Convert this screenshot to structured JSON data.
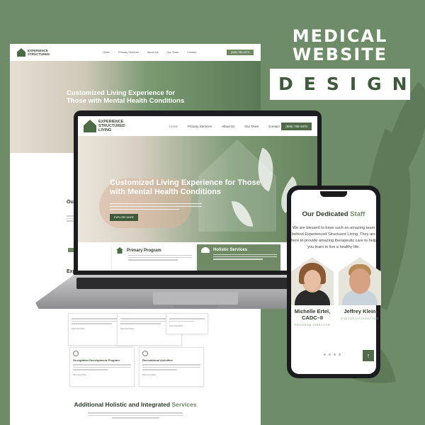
{
  "banner": {
    "line1": "MEDICAL",
    "line2": "WEBSITE",
    "line3": "DESIGN"
  },
  "brand": {
    "name_line1": "EXPERIENCE",
    "name_line2": "STRUCTURED",
    "name_line3": "LIVING"
  },
  "nav": {
    "items": [
      "Home",
      "Primary Services",
      "About Us",
      "Our Team",
      "Contact"
    ],
    "cta": "(888) 786-4870"
  },
  "hero": {
    "headline": "Customized Living Experience for Those with Mental Health Conditions",
    "button": "EXPLORE MORE"
  },
  "services_cards": [
    {
      "title": "Primary Program"
    },
    {
      "title": "Holistic Services"
    }
  ],
  "page_sections": {
    "expertise_stub": "Exp",
    "about_stub": "Our",
    "cards": [
      {
        "title": "Occupation Development Program",
        "more": "Find Out More"
      },
      {
        "title": "Recreational Activities",
        "more": "Find Out More"
      }
    ],
    "more_links": [
      "Find Out More",
      "Find Out More",
      "Find Out More"
    ],
    "additional_title": "Additional Holistic and Integrated",
    "additional_accent": "Services"
  },
  "phone": {
    "title": "Our Dedicated",
    "title_accent": "Staff",
    "body_lines": [
      "We are blessed to have such an amazing team",
      "behind Experienced Structured Living. They are",
      "here to provide amazing therapeutic care to  help",
      "you learn to live a healthy life."
    ],
    "staff": [
      {
        "name_line1": "Michelle Ertel,",
        "name_line2": "CADC–II",
        "role": "PROGRAM DIRECTOR"
      },
      {
        "name_line1": "Jeffrey Klein",
        "name_line2": "",
        "role": "EXECUTIVE DIRECTOR"
      }
    ],
    "scroll_top": "↑"
  },
  "colors": {
    "background": "#6f8c68",
    "accent": "#6f8a65",
    "dark_green": "#4f6b47"
  }
}
